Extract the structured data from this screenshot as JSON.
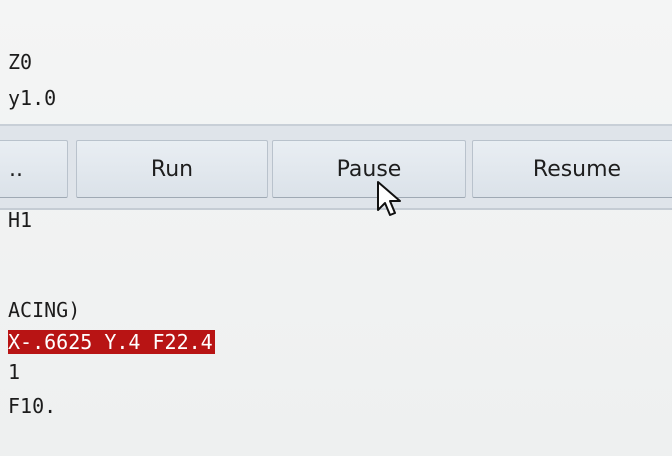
{
  "code_top": {
    "line1": "Z0",
    "line2": "y1.0"
  },
  "toolbar": {
    "partial_label": "..",
    "run_label": "Run",
    "pause_label": "Pause",
    "resume_label": "Resume"
  },
  "code_bottom": {
    "line1": "H1",
    "line2": "ACING)",
    "line3_highlighted": "X-.6625 Y.4 F22.4",
    "line4": "1",
    "line5": "F10."
  },
  "colors": {
    "highlight_bg": "#b81414",
    "highlight_text": "#ffffff",
    "toolbar_bg": "#dfe4ea"
  },
  "icons": {
    "cursor": "mouse-pointer-icon"
  }
}
